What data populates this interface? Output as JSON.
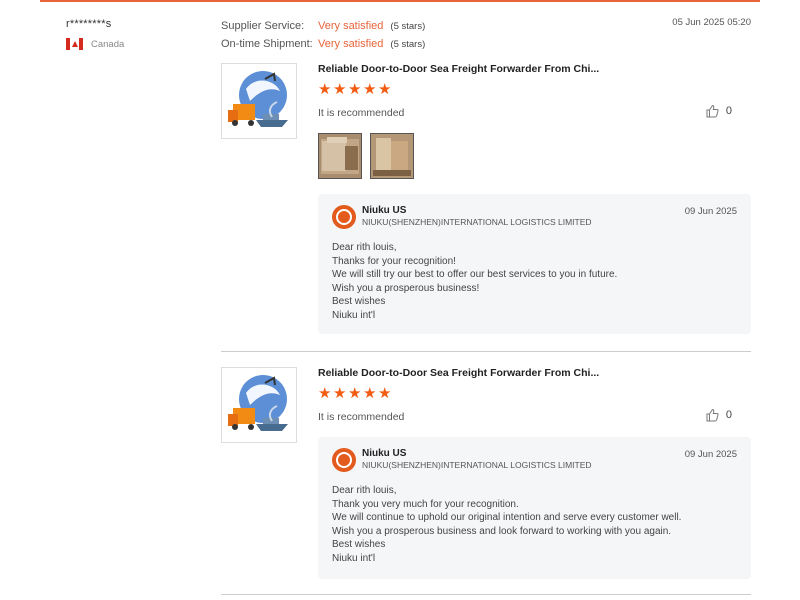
{
  "reviewer": {
    "name": "r********s",
    "country": "Canada"
  },
  "ratings": [
    {
      "label": "Supplier Service:",
      "value": "Very satisfied",
      "count": "(5 stars)"
    },
    {
      "label": "On-time Shipment:",
      "value": "Very satisfied",
      "count": "(5 stars)"
    }
  ],
  "date": "05 Jun 2025 05:20",
  "reviews": [
    {
      "product_title": "Reliable Door-to-Door Sea Freight Forwarder From Chi...",
      "recommend": "It is recommended",
      "likes": "0",
      "stars": 5,
      "reply": {
        "company": "Niuku US",
        "company_full": "NIUKU(SHENZHEN)INTERNATIONAL LOGISTICS LIMITED",
        "date": "09 Jun 2025",
        "lines": [
          "Dear rith louis,",
          "Thanks for your recognition!",
          "We will still try our best to offer our best services to you in future.",
          "Wish you a prosperous business!",
          "Best wishes",
          "Niuku int'l"
        ]
      }
    },
    {
      "product_title": "Reliable Door-to-Door Sea Freight Forwarder From Chi...",
      "recommend": "It is recommended",
      "likes": "0",
      "stars": 5,
      "reply": {
        "company": "Niuku US",
        "company_full": "NIUKU(SHENZHEN)INTERNATIONAL LOGISTICS LIMITED",
        "date": "09 Jun 2025",
        "lines": [
          "Dear rith louis,",
          "Thank you very much for your recognition.",
          "We will continue to uphold our original intention and serve every customer well.",
          "Wish you a prosperous business and look forward to working with you again.",
          "Best wishes",
          "Niuku int'l"
        ]
      }
    }
  ],
  "colors": {
    "accent": "#e8643a",
    "star": "#f25b12",
    "reply_bg": "#f5f6f8"
  }
}
